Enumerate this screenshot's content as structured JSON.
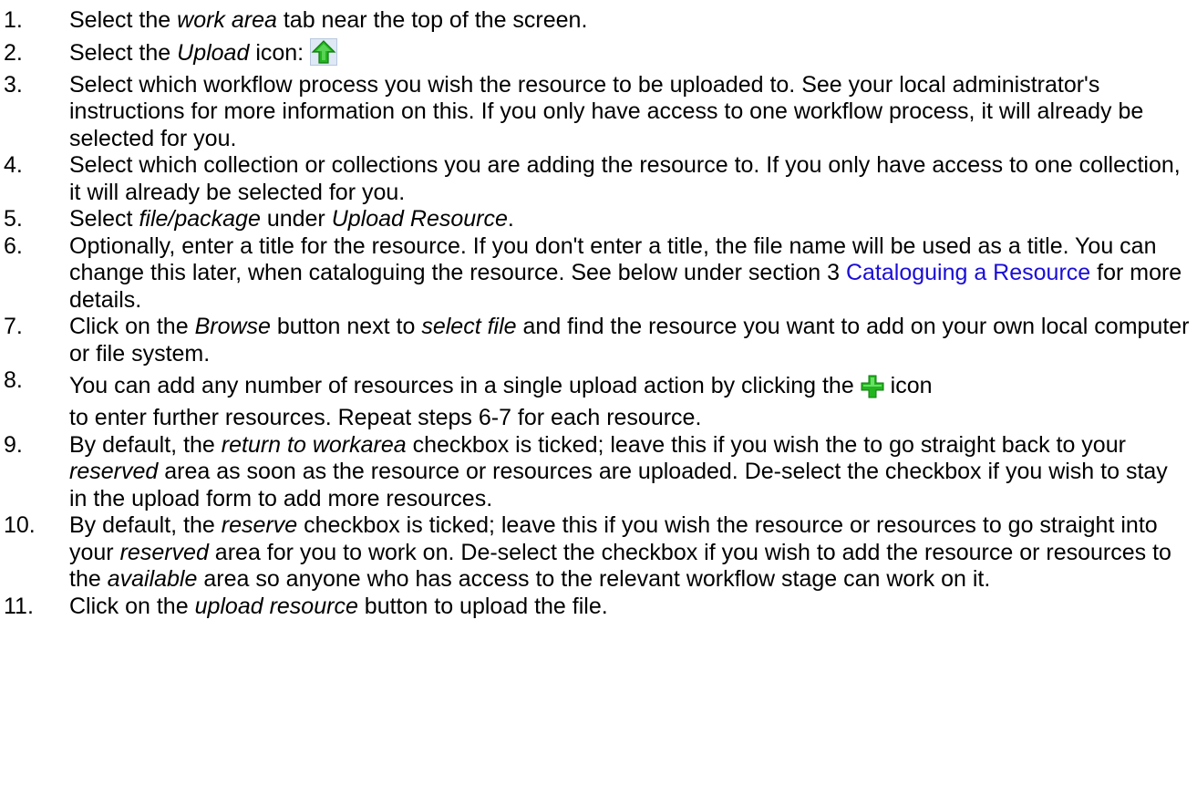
{
  "colors": {
    "text": "#000000",
    "link": "#1a0dd6",
    "icon_green": "#22b51f"
  },
  "steps": [
    {
      "num": "1.",
      "t1": "Select the ",
      "e1": "work area",
      "t2": " tab near the top of the screen."
    },
    {
      "num": "2.",
      "t1": "Select the ",
      "e1": "Upload",
      "t2": " icon: ",
      "icon": "upload-arrow-icon"
    },
    {
      "num": "3.",
      "text": "Select which workflow process you wish the resource to be uploaded to. See your local administrator's instructions for more information on this. If you only have access to one workflow process, it will already be selected for you."
    },
    {
      "num": "4.",
      "text": "Select which collection or collections you are adding the resource to. If you only have access to one collection, it will already be selected for you."
    },
    {
      "num": "5.",
      "t1": "Select ",
      "e1": "file/package",
      "t2": " under ",
      "e2": "Upload Resource",
      "t3": "."
    },
    {
      "num": "6.",
      "t1": "Optionally, enter a title for the resource. If you don't enter a title, the file name will be used as a title. You can change this later, when cataloguing the resource. See below under section 3 ",
      "link": "Cataloguing a Resource",
      "t2": " for more details."
    },
    {
      "num": "7.",
      "t1": "Click on the ",
      "e1": "Browse",
      "t2": " button next to ",
      "e2": "select file",
      "t3": " and find the resource you want to add on your own local computer or file system."
    },
    {
      "num": "8.",
      "t1": "You can add any number of resources in a single upload action by clicking the ",
      "icon": "add-plus-icon",
      "t2": " icon",
      "t3": "to enter further resources. Repeat steps 6-7 for each resource."
    },
    {
      "num": "9.",
      "t1": "By default, the ",
      "e1": "return to workarea",
      "t2": " checkbox is ticked; leave this if you wish the to go straight back to your ",
      "e2": "reserved",
      "t3": " area as soon as the resource or resources are uploaded. De-select the checkbox if you wish to stay in the upload form to add more resources."
    },
    {
      "num": "10.",
      "t1": "By default, the ",
      "e1": "reserve",
      "t2": " checkbox is ticked; leave this if you wish the resource or resources to go straight into your ",
      "e2": "reserved",
      "t3": " area for you to work on. De-select the checkbox if you wish to add the resource or resources to the ",
      "e3": "available",
      "t4": " area so anyone who has access to the relevant workflow stage can work on it."
    },
    {
      "num": "11.",
      "t1": "Click on the ",
      "e1": "upload resource",
      "t2": " button to upload the file."
    }
  ]
}
